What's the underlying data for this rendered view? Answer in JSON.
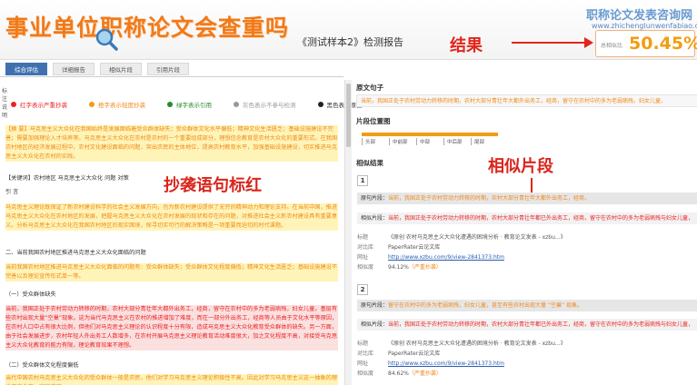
{
  "overlay_title": "事业单位职称论文会查重吗",
  "report_title": "《测试样本2》检测报告",
  "result_label": "结果",
  "watermark": "职称论文发表咨询网",
  "watermark_url": "www.zhichenglunwenfabiao.com",
  "score": {
    "label": "总相似比",
    "value": "50.45%"
  },
  "tabs": [
    "综合评估",
    "详细报告",
    "相似片段",
    "引用片段"
  ],
  "legend_header": "标注说明",
  "legend": [
    {
      "label": "红字表示严重抄袭",
      "color": "#e22"
    },
    {
      "label": "橙字表示轻度抄袭",
      "color": "#f39c12"
    },
    {
      "label": "绿字表示引用",
      "color": "#2a8a2a"
    },
    {
      "label": "灰色表示不参与检测",
      "color": "#999"
    },
    {
      "label": "黑色表示原创",
      "color": "#222"
    }
  ],
  "plag_label": "抄袭语句标红",
  "sim_label": "相似片段",
  "left_text": {
    "abstract": "【摘 要】马克思主义大众化在我国始终是发展面临着受众群体缺失；受众群体文化水平偏低；精神文化生活匮乏；基础设施建设不完善；需要加强理论入才培养等。马克思主义大众化在农村是农村的一个重要组成部分，理想信念教育是农村大众化的重要形式。在我国农村地区的经济发展过程中，农村文化建设面临的问题，突出农民的主体地位，提高农村教育水平，加强基础设施建设，切实推进马克思主义大众化在农村的实践。",
    "keywords": "【关键词】农村地区 马克思主义大众化 问题 对策",
    "intro_head": "引 言",
    "intro": "马克思主义理论既保证了新农村建设科学的社会主义发展方向，也为新农村建设提供了无穷的精神动力和理论支持。在当前中国，推进马克思主义大众化在农村地区的发展，把握马克思主义大众化在农村发展的现状和存在的问题，对推进社会主义新农村建设具有重要意义。分析马克思主义大众化在我国农村地区的现实困境，探寻切实可行的解决策略是一项重要而迫切的时代课题。",
    "section2": "二、当前我国农村地区推进马克思主义大众化面临的问题",
    "section2_p": "当前我国农村地区推进马克思主义大众化面临的问题有：受众群体缺失；受众群体文化程度偏低；精神文化生活匮乏；基础设施建设不完善以及理论宣传形式单一等。",
    "sub1": "（一）受众群体缺失",
    "sub1_p": "当前，我国正处于农村劳动力转移的时期，农村大部分青壮年大都外出务工，经商，留守在农村中的多为老弱病残，妇女儿童，基层有些农村出现大量“空巢”现象。这为当代马克思主义在农村的推进增加了难度，而在一部分外出务工，经商等人员由于文化水平等原因，在农村人口中占有很大比例，但他们对马克思主义理论的认识程度十分有限，造成马克思主义大众化教育受众群体的缺失。另一方面，由于社会发展进步，农村年轻人外出务工人数增多，在农村开展马克思主义理论教育活动难度很大，加之文化程度不高，对接受马克思主义大众化教育的能力有限，理论教育效果不理想。",
    "sub2": "（二）受众群体文化程度偏低",
    "sub2_p": "当代中国农村马克思主义大众化的受众群体一般是农民，他们对学习马克思主义理论积极性不高。因此对学习马克思主义这一抽象的理论内容会有一定的难度。"
  },
  "right": {
    "orig_title": "原文句子",
    "orig_text": "当前，我国正处于农村劳动力转移的时期，农村大部分青壮年大都外出务工，经商，留守在农村中的多为老弱病残，妇女儿童，",
    "pos_title": "片段位置图",
    "pos_labels": [
      "头部",
      "中前部",
      "中部",
      "中后部",
      "尾部"
    ],
    "sim_title": "相似结果",
    "results": [
      {
        "num": "1",
        "orig_label": "原句片段：",
        "orig": "当前，我国正处于农村劳动力转移的时期，农村大部分青壮年大都外出务工，经商，",
        "sim_label": "相似片段：",
        "sim": "当前，我国正处于农村劳动力转移的时期，农村大部分青壮年都已外出务工，经商，留守在农村中的多为老弱病残与妇女儿童，",
        "meta": [
          {
            "k": "标题",
            "v": "《原创 农村马克思主义大众化遭遇的困境分析 · 教育论文发表 - xzbu...》"
          },
          {
            "k": "对比库",
            "v": "PaperRater云论文库"
          },
          {
            "k": "网址",
            "v": "http://www.xzbu.com/9/view-2841373.htm",
            "link": true
          },
          {
            "k": "相似度",
            "v": "94.12%",
            "tag": "（严重抄袭）"
          }
        ]
      },
      {
        "num": "2",
        "orig_label": "原句片段：",
        "orig": "留守在农村中的多为老弱病残，妇女儿童，甚至有些农村出现大量 “空巢” 现象。",
        "sim_label": "相似片段：",
        "sim": "当前，我国正处于农村劳动力转移的时期，农村大部分青壮年都已外出务工，经商，留守在农村中的多为老弱病残与妇女儿童，",
        "meta": [
          {
            "k": "标题",
            "v": "《原创 农村马克思主义大众化遭遇的困境分析 · 教育论文发表 - xzbu...》"
          },
          {
            "k": "对比库",
            "v": "PaperRater云论文库"
          },
          {
            "k": "网址",
            "v": "http://www.xzbu.com/9/view-2841373.htm",
            "link": true
          },
          {
            "k": "相似度",
            "v": "84.62%",
            "tag": "（严重抄袭）"
          }
        ]
      }
    ]
  }
}
